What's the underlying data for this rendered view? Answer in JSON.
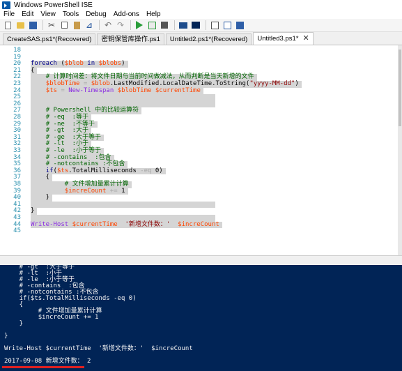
{
  "window": {
    "title": "Windows PowerShell ISE"
  },
  "menu": [
    "File",
    "Edit",
    "View",
    "Tools",
    "Debug",
    "Add-ons",
    "Help"
  ],
  "tabs": [
    {
      "label": "CreateSAS.ps1*(Recovered)"
    },
    {
      "label": "密钥保管库操作.ps1"
    },
    {
      "label": "Untitled2.ps1*(Recovered)"
    },
    {
      "label": "Untitled3.ps1*",
      "close": "✕"
    }
  ],
  "editor": {
    "lines": [
      {
        "n": "18",
        "t": ""
      },
      {
        "n": "19",
        "t": ""
      },
      {
        "n": "20",
        "t": "foreach ($blob in $blobs)"
      },
      {
        "n": "21",
        "t": "{"
      },
      {
        "n": "22",
        "t": "    # 计算时间差：将文件日期与当前时间做减法，从而判断是当天新增的文件"
      },
      {
        "n": "23",
        "t": "    $blobTime = $blob.LastModified.LocalDateTime.ToString(\"yyyy-MM-dd\")"
      },
      {
        "n": "24",
        "t": "    $ts = New-Timespan $blobTime $currentTime"
      },
      {
        "n": "25",
        "t": ""
      },
      {
        "n": "26",
        "t": ""
      },
      {
        "n": "27",
        "t": "    # Powershell 中的比较运算符"
      },
      {
        "n": "28",
        "t": "    # -eq  :等于"
      },
      {
        "n": "29",
        "t": "    # -ne  :不等于"
      },
      {
        "n": "30",
        "t": "    # -gt  :大于"
      },
      {
        "n": "31",
        "t": "    # -ge  :大于等于"
      },
      {
        "n": "32",
        "t": "    # -lt  :小于"
      },
      {
        "n": "33",
        "t": "    # -le  :小于等于"
      },
      {
        "n": "34",
        "t": "    # -contains  :包含"
      },
      {
        "n": "35",
        "t": "    # -notcontains :不包含"
      },
      {
        "n": "36",
        "t": "    if($ts.TotalMilliseconds -eq 0)"
      },
      {
        "n": "37",
        "t": "    {"
      },
      {
        "n": "38",
        "t": "         # 文件增加量累计计算"
      },
      {
        "n": "39",
        "t": "         $increCount += 1"
      },
      {
        "n": "40",
        "t": "    }"
      },
      {
        "n": "41",
        "t": ""
      },
      {
        "n": "42",
        "t": "}"
      },
      {
        "n": "43",
        "t": ""
      },
      {
        "n": "44",
        "t": "Write-Host $currentTime  '新增文件数：'  $increCount"
      },
      {
        "n": "45",
        "t": ""
      }
    ]
  },
  "console": {
    "lines": [
      "    # -gt  :大于等于",
      "    # -lt  :小于",
      "    # -le  :小于等于",
      "    # -contains  :包含",
      "    # -notcontains :不包含",
      "    if($ts.TotalMilliseconds -eq 0)",
      "    {",
      "         # 文件增加量累计计算",
      "         $increCount += 1",
      "    }",
      "",
      "}",
      "",
      "Write-Host $currentTime  '新增文件数：'  $increCount",
      "",
      "2017-09-08 新增文件数： 2"
    ]
  },
  "colors": {
    "console_bg": "#012456",
    "highlight": "#d5d5d5",
    "underline": "#e02020"
  }
}
